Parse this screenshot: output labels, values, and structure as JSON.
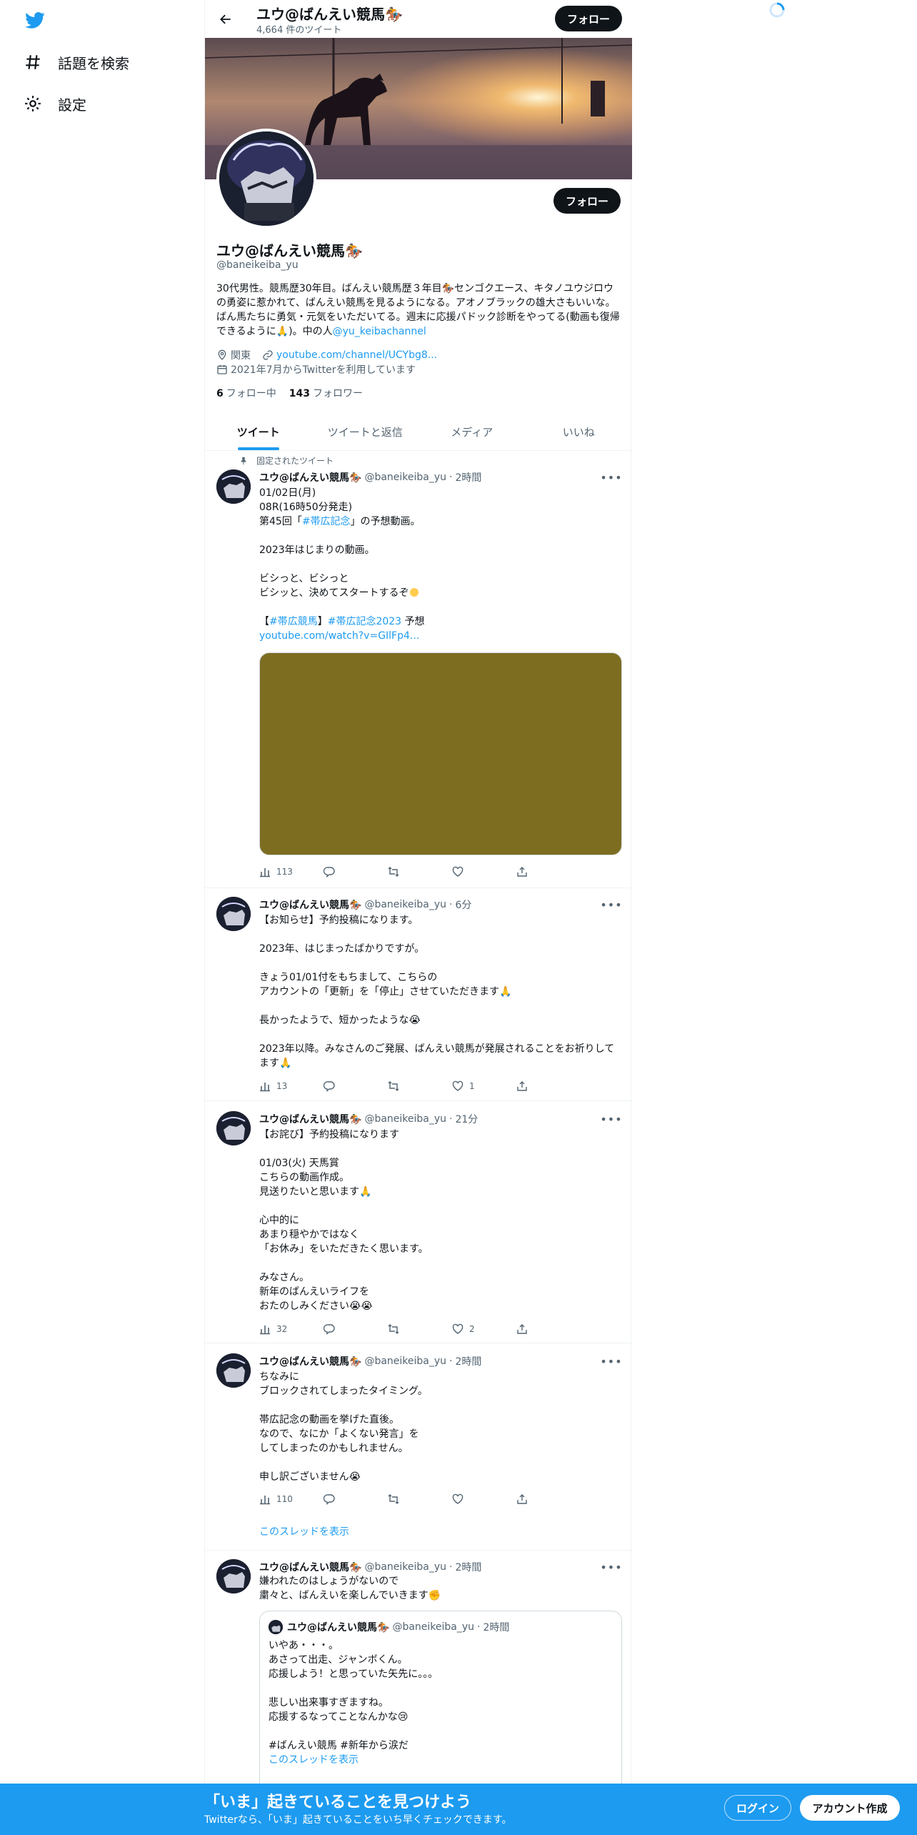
{
  "nav": {
    "explore_label": "話題を検索",
    "settings_label": "設定"
  },
  "header": {
    "name": "ユウ@ばんえい競馬🏇",
    "tweet_count": "4,664 件のツイート",
    "follow_label": "フォロー"
  },
  "profile": {
    "name": "ユウ@ばんえい競馬🏇",
    "handle": "@baneikeiba_yu",
    "follow_label": "フォロー",
    "bio_text": "30代男性。競馬歴30年目。ばんえい競馬歴３年目🏇センゴクエース、キタノユウジロウの勇姿に惹かれて、ばんえい競馬を見るようになる。アオノブラックの雄大さもいいな。ばん馬たちに勇気・元気をいただいてる。週末に応援パドック診断をやってる(動画も復帰できるように🙏)。中の人",
    "bio_link": "@yu_keibachannel",
    "location": "関東",
    "url": "youtube.com/channel/UCYbg8...",
    "joined": "2021年7月からTwitterを利用しています",
    "following_count": "6",
    "following_label": "フォロー中",
    "followers_count": "143",
    "followers_label": "フォロワー"
  },
  "tabs": [
    "ツイート",
    "ツイートと返信",
    "メディア",
    "いいね"
  ],
  "pinned_label": "固定されたツイート",
  "tweets": [
    {
      "name": "ユウ@ばんえい競馬🏇",
      "handle": "@baneikeiba_yu",
      "time": "2時間",
      "l1": "01/02日(月)",
      "l2": "08R(16時50分発走)",
      "l3a": "第45回「",
      "l3link": "#帯広記念",
      "l3b": "」の予想動画。",
      "l4": "2023年はじまりの動画。",
      "l5": "ビシっと、ビシっと",
      "l6": "ビシッと、決めてスタートするぞ",
      "l7a": "【",
      "l7link1": "#帯広競馬",
      "l7b": "】",
      "l7link2": "#帯広記念2023",
      "l7c": " 予想",
      "l8link": "youtube.com/watch?v=GIlFp4...",
      "views": "113",
      "replies": "",
      "retweets": "",
      "likes": ""
    },
    {
      "name": "ユウ@ばんえい競馬🏇",
      "handle": "@baneikeiba_yu",
      "time": "6分",
      "lines": [
        "【お知らせ】予約投稿になります。",
        "",
        "2023年、はじまったばかりですが。",
        "",
        "きょう01/01付をもちまして、こちらの",
        "アカウントの「更新」を「停止」させていただきます🙏",
        "",
        "長かったようで、短かったような😭",
        "",
        "2023年以降。みなさんのご発展、ばんえい競馬が発展されることをお祈りしてます🙏"
      ],
      "views": "13",
      "likes": "1"
    },
    {
      "name": "ユウ@ばんえい競馬🏇",
      "handle": "@baneikeiba_yu",
      "time": "21分",
      "lines": [
        "【お詫び】予約投稿になります",
        "",
        "01/03(火) 天馬賞",
        "こちらの動画作成。",
        "見送りたいと思います🙏",
        "",
        "心中的に",
        "あまり穏やかではなく",
        "「お休み」をいただきたく思います。",
        "",
        "みなさん。",
        "新年のばんえいライフを",
        "おたのしみください😭😭"
      ],
      "views": "32",
      "likes": "2"
    },
    {
      "name": "ユウ@ばんえい競馬🏇",
      "handle": "@baneikeiba_yu",
      "time": "2時間",
      "lines": [
        "ちなみに",
        "ブロックされてしまったタイミング。",
        "",
        "帯広記念の動画を挙げた直後。",
        "なので、なにか「よくない発言」を",
        "してしまったのかもしれません。",
        "",
        "申し訳ございません😭"
      ],
      "views": "110",
      "show_thread": "このスレッドを表示"
    },
    {
      "name": "ユウ@ばんえい競馬🏇",
      "handle": "@baneikeiba_yu",
      "time": "2時間",
      "lines": [
        "嫌われたのはしょうがないので",
        "粛々と、ばんえいを楽しんでいきます✊"
      ],
      "quote": {
        "name": "ユウ@ばんえい競馬🏇",
        "handle": "@baneikeiba_yu",
        "time": "2時間",
        "lines": [
          "いやあ・・・。",
          "あさって出走、ジャンボくん。",
          "応援しよう！と思っていた矢先に。。。",
          "",
          "悲しい出来事すぎますね。",
          "応援するなってことなんかな😢",
          "",
          "#ばんえい競馬 #新年から涙だ"
        ],
        "show_thread": "このスレッドを表示"
      }
    }
  ],
  "bottom_bar": {
    "title": "「いま」起きていることを見つけよう",
    "subtitle": "Twitterなら、「いま」起きていることをいち早くチェックできます。",
    "login": "ログイン",
    "signup": "アカウント作成"
  },
  "colors": {
    "accent": "#1d9bf0",
    "dark": "#0f1419",
    "muted": "#536471"
  }
}
